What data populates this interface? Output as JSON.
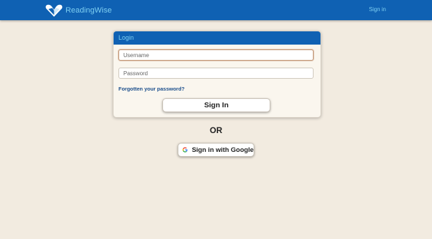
{
  "header": {
    "brand_name": "ReadingWise",
    "signin_link": "Sign in",
    "logo_icon": "readingwise-heart-book-logo",
    "background_color": "#0f61b3",
    "link_color": "#7fd0f2"
  },
  "login": {
    "title": "Login",
    "username_placeholder": "Username",
    "username_value": "",
    "password_placeholder": "Password",
    "password_value": "",
    "forgot_link": "Forgotten your password?",
    "signin_button": "Sign In"
  },
  "separator": {
    "text": "OR"
  },
  "google": {
    "button_label": "Sign in with Google",
    "icon": "google-g-icon"
  },
  "colors": {
    "page_background": "#f2ebe0",
    "panel_background": "#faf6ee",
    "link_dark": "#1c4f8c"
  }
}
